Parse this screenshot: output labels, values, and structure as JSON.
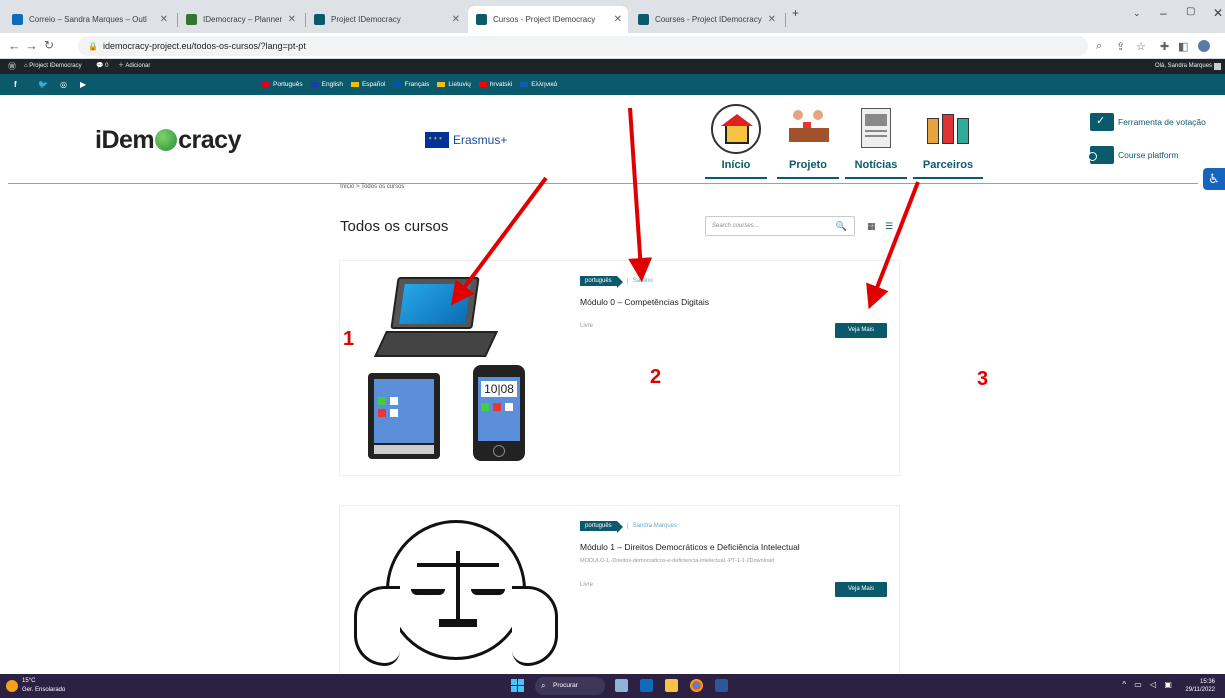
{
  "browser": {
    "tabs": [
      {
        "title": "Correio – Sandra Marques – Outl",
        "icon_color": "#0f6cbd",
        "active": false
      },
      {
        "title": "IDemocracy – Planner",
        "icon_color": "#31752f",
        "active": false
      },
      {
        "title": "Project IDemocracy",
        "icon_color": "#0b5a6b",
        "active": false
      },
      {
        "title": "Cursos - Project IDemocracy",
        "icon_color": "#0b5a6b",
        "active": true
      },
      {
        "title": "Courses - Project IDemocracy",
        "icon_color": "#0b5a6b",
        "active": false
      }
    ],
    "new_tab": "+",
    "url": "idemocracy-project.eu/todos-os-cursos/?lang=pt-pt"
  },
  "wp_admin_bar": {
    "site": "Project IDemocracy",
    "comments": "0",
    "add_new": "Adicionar",
    "greeting": "Olá, Sandra Marques"
  },
  "languages": [
    "Português",
    "English",
    "Español",
    "Français",
    "Lietuvių",
    "hrvatski",
    "Ελληνικά"
  ],
  "language_flag_colors": [
    "#e0001b",
    "#1a3fa0",
    "#f1bf00",
    "#0055a4",
    "#fdb913",
    "#ff0000",
    "#0d5eaf"
  ],
  "social": [
    "f",
    "t",
    "ig",
    "yt"
  ],
  "header": {
    "logo_left": "iDem",
    "logo_right": "cracy",
    "erasmus": "Erasmus+",
    "nav": [
      "Início",
      "Projeto",
      "Notícias",
      "Parceiros"
    ],
    "right_links": [
      "Ferramenta de votação",
      "Course platform"
    ]
  },
  "breadcrumb": "Início > Todos os cursos",
  "page_title": "Todos os cursos",
  "search_placeholder": "Search courses...",
  "courses": [
    {
      "tag": "português",
      "author": "Saulino",
      "title": "Módulo 0 – Competências Digitais",
      "subtitle": "",
      "price": "Livre",
      "button": "Veja Mais"
    },
    {
      "tag": "português",
      "author": "Sandra Marques",
      "title": "Módulo 1 – Direitos Democráticos e Deficiência Intelectual",
      "subtitle": "MODULO-1.-Direitos-democraticos-e-deficiencia-intelectual.-PT-1-1-2Download",
      "price": "Livre",
      "button": "Veja Mais"
    }
  ],
  "phone_clock": [
    "10",
    "08"
  ],
  "annotations": [
    "1",
    "2",
    "3"
  ],
  "annotation_color": "#e00000",
  "taskbar": {
    "temp": "15°C",
    "weather": "Ger. Ensolarado",
    "search": "Procurar",
    "time": "15:36",
    "date": "29/11/2022"
  },
  "accent": "#0b5a6b"
}
